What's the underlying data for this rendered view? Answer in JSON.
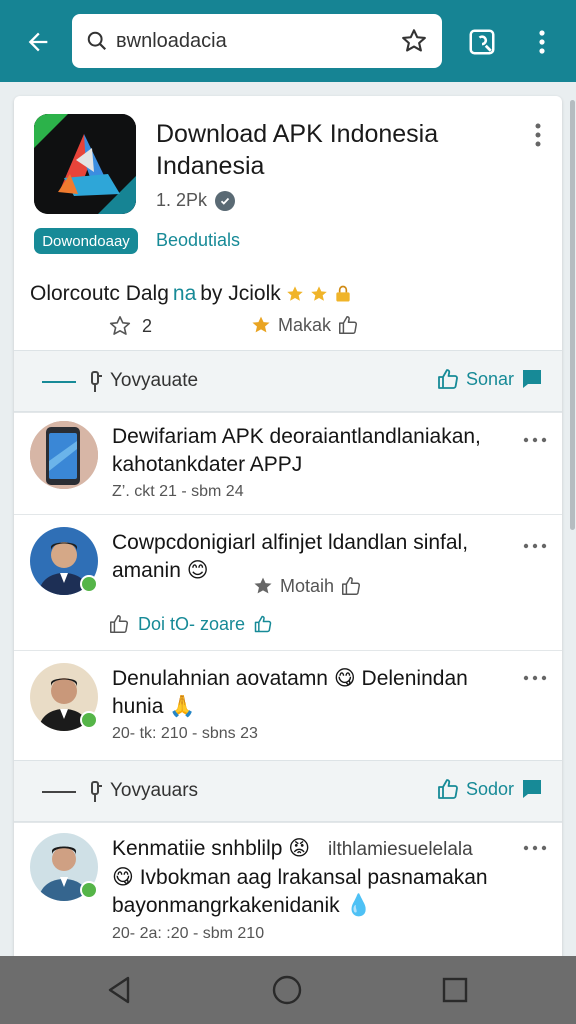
{
  "search": {
    "query": "вwnloadacia"
  },
  "app": {
    "title": "Download APK Indonesia Indanesia",
    "count": "1. 2Pk",
    "download_label": "Dowondoaay",
    "details_label": "Beodutials",
    "desc_a": "Olorcoutc Dalg",
    "desc_hl": "na",
    "desc_b": "by Jciolk",
    "rating_value": "2",
    "make_label": "Makak"
  },
  "sections": [
    {
      "label": "Yovyauate",
      "action": "Sonar"
    },
    {
      "label": "Yovyauars",
      "action": "Sodor"
    }
  ],
  "posts": [
    {
      "title": "Dewifariam APK deoraiantlandlaniakan, kahotankdater APPJ",
      "meta": "Z’. ckt 21  -  sbm 24"
    },
    {
      "title": "Cowpcdonigiarl alfinjet ldandlan sinfal, amanin 😊",
      "action": "Motaih",
      "share": "Doi  tO- zoare"
    },
    {
      "title": "Denulahnian aovatamn 😋 Delenindan hunia 🙏",
      "meta": "20- tk: 210 -  sbns 23"
    },
    {
      "title_a": "Kenmatiie snhblilp 😡",
      "title_b": "ilthlamiesuelelala",
      "title_c": "😋 Ivbokman aag lrakansal pasnamakan bayonmangrkakenidanik 💧",
      "meta": "20- 2a: :20 -  sbm 210"
    }
  ],
  "colors": {
    "teal": "#168494",
    "link": "#178a97",
    "star": "#e9a422"
  }
}
